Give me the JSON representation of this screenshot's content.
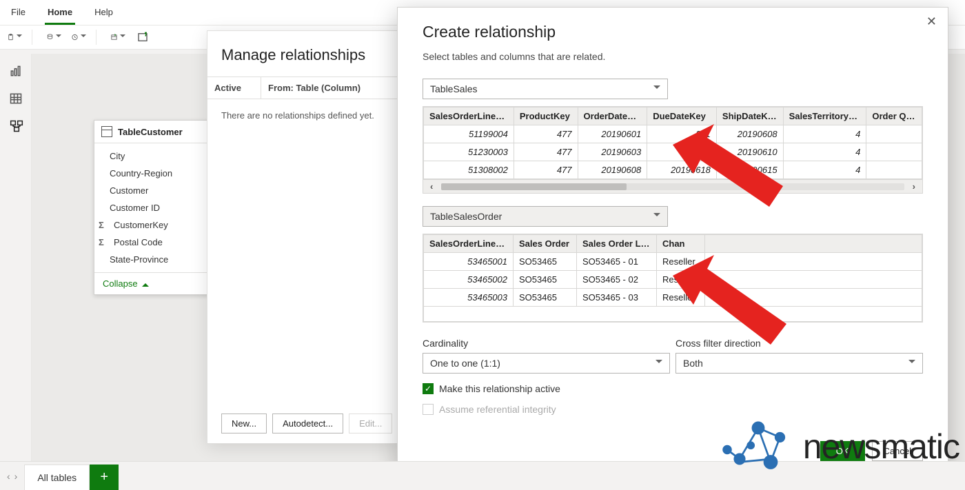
{
  "menu": {
    "file": "File",
    "home": "Home",
    "help": "Help"
  },
  "tableCard": {
    "title": "TableCustomer",
    "fields": [
      "City",
      "Country-Region",
      "Customer",
      "Customer ID",
      "CustomerKey",
      "Postal Code",
      "State-Province"
    ],
    "sigmaIndices": [
      4,
      5
    ],
    "collapse": "Collapse"
  },
  "managePanel": {
    "title": "Manage relationships",
    "col1": "Active",
    "col2": "From: Table (Column)",
    "empty": "There are no relationships defined yet.",
    "new": "New...",
    "auto": "Autodetect...",
    "edit": "Edit..."
  },
  "dialog": {
    "title": "Create relationship",
    "subtitle": "Select tables and columns that are related.",
    "tableA": "TableSales",
    "previewA": {
      "headers": [
        "SalesOrderLineKey",
        "ProductKey",
        "OrderDateKey",
        "DueDateKey",
        "ShipDateKey",
        "SalesTerritoryKey",
        "Order Qua"
      ],
      "rows": [
        [
          "51199004",
          "477",
          "20190601",
          "201",
          "20190608",
          "4",
          ""
        ],
        [
          "51230003",
          "477",
          "20190603",
          "20190",
          "20190610",
          "4",
          ""
        ],
        [
          "51308002",
          "477",
          "20190608",
          "20190618",
          "190615",
          "4",
          ""
        ]
      ]
    },
    "tableB": "TableSalesOrder",
    "previewB": {
      "headers": [
        "SalesOrderLineKey",
        "Sales Order",
        "Sales Order Line",
        "Chan"
      ],
      "rows": [
        [
          "53465001",
          "SO53465",
          "SO53465 - 01",
          "Reseller"
        ],
        [
          "53465002",
          "SO53465",
          "SO53465 - 02",
          "Reseller"
        ],
        [
          "53465003",
          "SO53465",
          "SO53465 - 03",
          "Reseller"
        ]
      ]
    },
    "cardinalityLabel": "Cardinality",
    "cardinalityValue": "One to one (1:1)",
    "crossLabel": "Cross filter direction",
    "crossValue": "Both",
    "activeChk": "Make this relationship active",
    "refChk": "Assume referential integrity",
    "ok": "OK",
    "cancel": "Cancel"
  },
  "bottom": {
    "tab": "All tables"
  },
  "watermark": "newsmatic"
}
